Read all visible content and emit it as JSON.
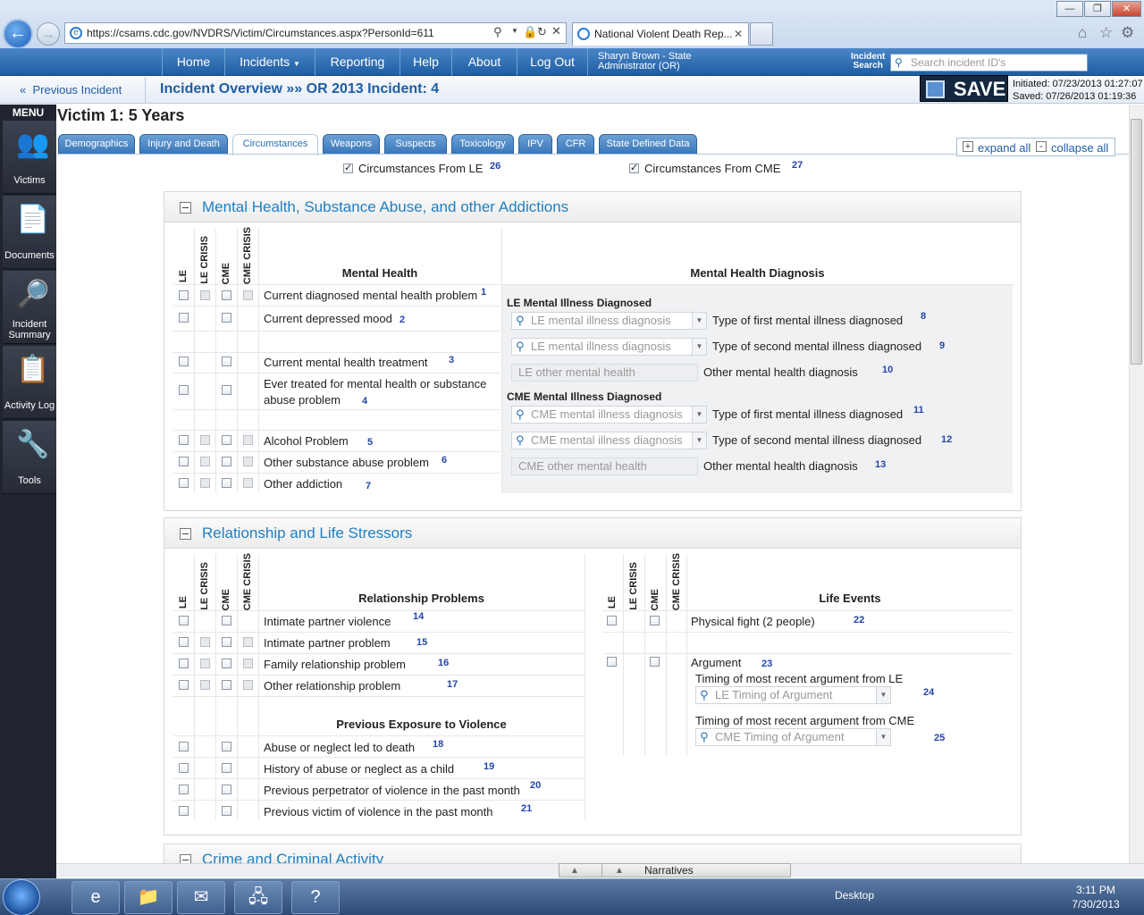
{
  "browser": {
    "url": "https://csams.cdc.gov/NVDRS/Victim/Circumstances.aspx?PersonId=611",
    "url_domain": "csams.cdc.gov",
    "tab_title": "National Violent Death Rep..."
  },
  "nav": {
    "items": [
      "Home",
      "Incidents",
      "Reporting",
      "Help",
      "About",
      "Log Out"
    ],
    "user_line1": "Sharyn Brown - State",
    "user_line2": "Administrator (OR)",
    "search_label1": "Incident",
    "search_label2": "Search",
    "search_placeholder": "Search incident ID's"
  },
  "crumb": {
    "previous": "Previous Incident",
    "overview": "Incident Overview »» OR 2013 Incident: 4",
    "save": "SAVE",
    "initiated": "Initiated: 07/23/2013 01:27:07",
    "saved": "Saved: 07/26/2013 01:19:36"
  },
  "sidebar": {
    "menu": "MENU",
    "items": [
      {
        "label": "Victims"
      },
      {
        "label": "Documents"
      },
      {
        "label": "Incident Summary"
      },
      {
        "label": "Activity Log"
      },
      {
        "label": "Tools"
      }
    ]
  },
  "victim_title": "Victim 1: 5 Years",
  "tabs": [
    "Demographics",
    "Injury and Death",
    "Circumstances",
    "Weapons",
    "Suspects",
    "Toxicology",
    "IPV",
    "CFR",
    "State Defined Data"
  ],
  "expand_all": "expand all",
  "collapse_all": "collapse all",
  "from_le": {
    "label": "Circumstances From LE",
    "num": "26"
  },
  "from_cme": {
    "label": "Circumstances From CME",
    "num": "27"
  },
  "col_heads": {
    "le": "LE",
    "le_crisis": "LE CRISIS",
    "cme": "CME",
    "cme_crisis": "CME CRISIS"
  },
  "mh": {
    "title": "Mental Health, Substance Abuse, and other Addictions",
    "left_head": "Mental Health",
    "right_head": "Mental Health Diagnosis",
    "rows": [
      {
        "label": "Current diagnosed mental health problem",
        "num": "1"
      },
      {
        "label": "Current depressed mood",
        "num": "2"
      },
      {
        "label": "Current mental health treatment",
        "num": "3"
      },
      {
        "label": "Ever treated for mental health or substance",
        "label2": "abuse problem",
        "num": "4"
      },
      {
        "label": "Alcohol Problem",
        "num": "5"
      },
      {
        "label": "Other substance abuse problem",
        "num": "6"
      },
      {
        "label": "Other addiction",
        "num": "7"
      }
    ],
    "le_diag_head": "LE Mental Illness Diagnosed",
    "cme_diag_head": "CME Mental Illness Diagnosed",
    "diag": [
      {
        "placeholder": "LE mental illness diagnosis",
        "label": "Type of first mental illness diagnosed",
        "num": "8"
      },
      {
        "placeholder": "LE mental illness diagnosis",
        "label": "Type of second mental illness diagnosed",
        "num": "9"
      },
      {
        "placeholder": "LE other mental health",
        "label": "Other mental health diagnosis",
        "num": "10"
      },
      {
        "placeholder": "CME mental illness diagnosis",
        "label": "Type of first mental illness diagnosed",
        "num": "11"
      },
      {
        "placeholder": "CME mental illness diagnosis",
        "label": "Type of second mental illness diagnosed",
        "num": "12"
      },
      {
        "placeholder": "CME other mental health",
        "label": "Other mental health diagnosis",
        "num": "13"
      }
    ]
  },
  "rel": {
    "title": "Relationship and Life Stressors",
    "rel_head": "Relationship Problems",
    "rows": [
      {
        "label": "Intimate partner violence",
        "num": "14"
      },
      {
        "label": "Intimate partner problem",
        "num": "15"
      },
      {
        "label": "Family relationship problem",
        "num": "16"
      },
      {
        "label": "Other relationship problem",
        "num": "17"
      }
    ],
    "exp_head": "Previous Exposure to Violence",
    "exp_rows": [
      {
        "label": "Abuse or neglect led to death",
        "num": "18"
      },
      {
        "label": "History of abuse or neglect as a child",
        "num": "19"
      },
      {
        "label": "Previous perpetrator of violence in the past month",
        "num": "20"
      },
      {
        "label": "Previous victim of violence in the past month",
        "num": "21"
      }
    ],
    "life_head": "Life Events",
    "fight": {
      "label": "Physical fight (2 people)",
      "num": "22"
    },
    "argument": {
      "label": "Argument",
      "num": "23"
    },
    "timing_le": {
      "label": "Timing of most recent argument from LE",
      "placeholder": "LE Timing of Argument",
      "num": "24"
    },
    "timing_cme": {
      "label": "Timing of most recent argument from CME",
      "placeholder": "CME Timing of Argument",
      "num": "25"
    }
  },
  "crime_title": "Crime and Criminal Activity",
  "narratives": "Narratives",
  "taskbar": {
    "desktop": "Desktop",
    "time": "3:11 PM",
    "date": "7/30/2013"
  }
}
